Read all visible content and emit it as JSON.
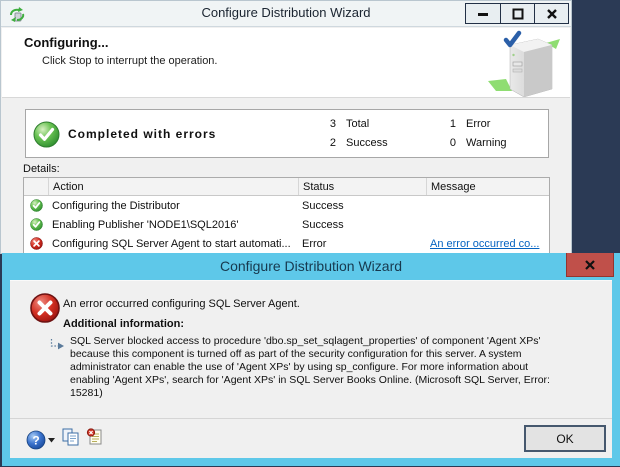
{
  "colors": {
    "desktop": "#2b3a55",
    "dialog_frame": "#5ec8e9",
    "close_button_red": "#c0504a",
    "success_green": "#3f9e3f",
    "error_red": "#c11f1f",
    "link_blue": "#0563c1"
  },
  "main_window": {
    "title": "Configure Distribution Wizard",
    "header": {
      "title": "Configuring...",
      "subtitle": "Click Stop to interrupt the operation."
    },
    "summary": {
      "status": "Completed with errors",
      "counts": [
        {
          "value": "3",
          "label": "Total"
        },
        {
          "value": "2",
          "label": "Success"
        },
        {
          "value": "1",
          "label": "Error"
        },
        {
          "value": "0",
          "label": "Warning"
        }
      ]
    },
    "details_label": "Details:",
    "table": {
      "columns": [
        "Action",
        "Status",
        "Message"
      ],
      "rows": [
        {
          "icon": "success",
          "action": "Configuring the Distributor",
          "status": "Success",
          "message": ""
        },
        {
          "icon": "success",
          "action": "Enabling Publisher 'NODE1\\SQL2016'",
          "status": "Success",
          "message": ""
        },
        {
          "icon": "error",
          "action": "Configuring SQL Server Agent to start automati...",
          "status": "Error",
          "message": "An error occurred co..."
        }
      ]
    }
  },
  "dialog": {
    "title": "Configure Distribution Wizard",
    "message": "An error occurred configuring SQL Server Agent.",
    "additional_info_label": "Additional information:",
    "detail": "SQL Server blocked access to procedure 'dbo.sp_set_sqlagent_properties' of component 'Agent XPs' because this component is turned off as part of the security configuration for this server. A system administrator can enable the use of 'Agent XPs' by using sp_configure. For more information about enabling 'Agent XPs', search for 'Agent XPs' in SQL Server Books Online. (Microsoft SQL Server, Error: 15281)",
    "ok_label": "OK"
  }
}
